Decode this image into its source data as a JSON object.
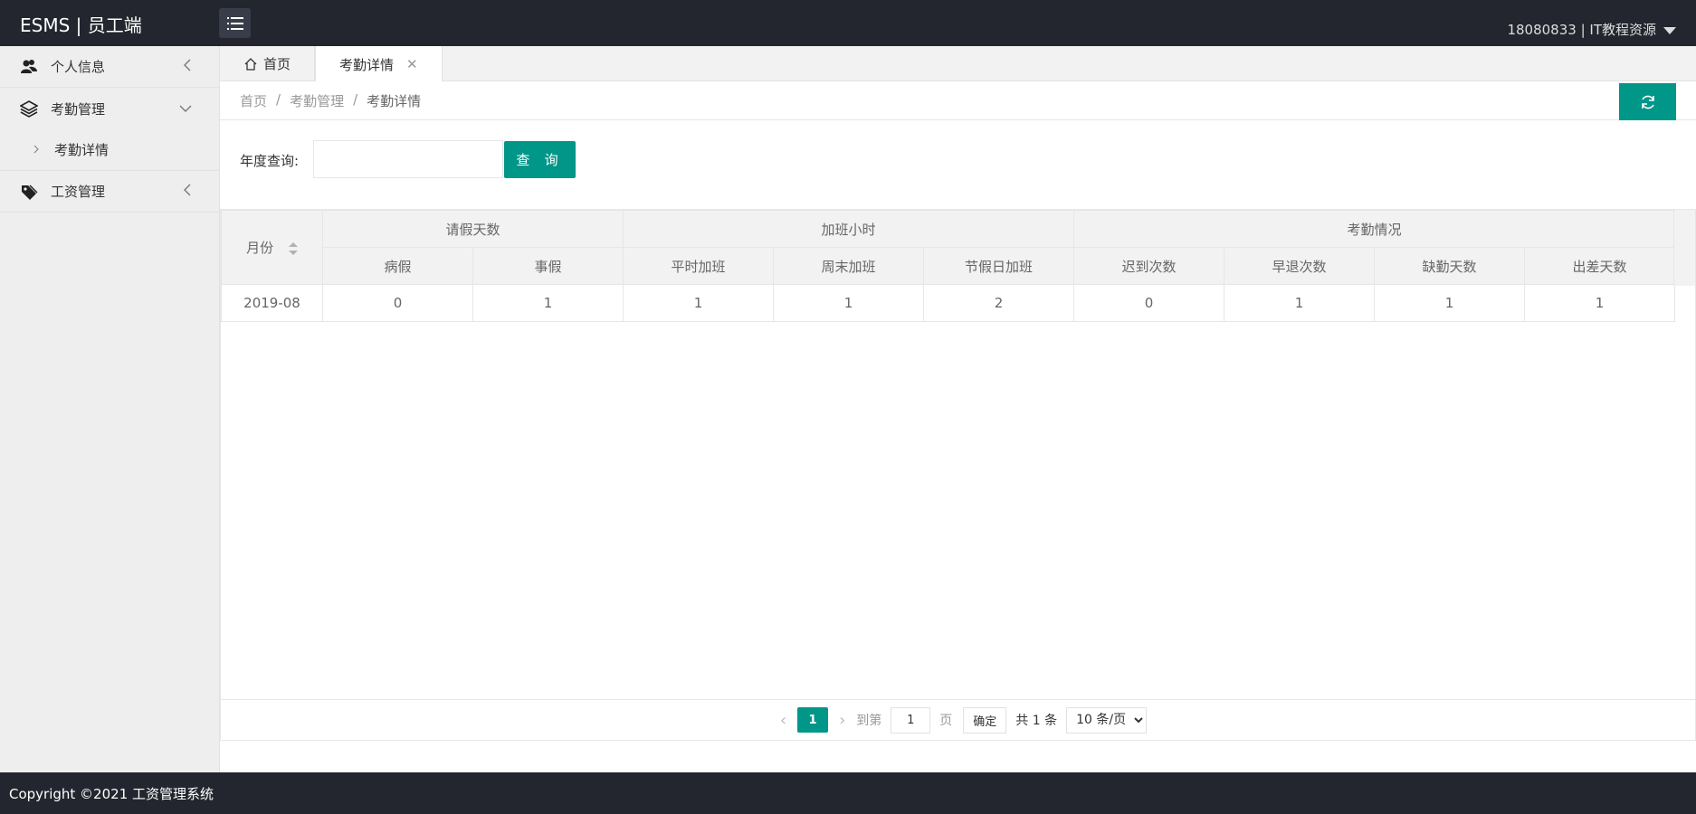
{
  "header": {
    "brand": "ESMS | 员工端",
    "user": "18080833 | IT教程资源"
  },
  "sidebar": {
    "items": [
      {
        "label": "个人信息",
        "icon": "user-group-icon",
        "expanded": false
      },
      {
        "label": "考勤管理",
        "icon": "layers-icon",
        "expanded": true,
        "children": [
          {
            "label": "考勤详情"
          }
        ]
      },
      {
        "label": "工资管理",
        "icon": "tag-icon",
        "expanded": false
      }
    ]
  },
  "tabs": [
    {
      "label": "首页",
      "icon": "home-icon"
    },
    {
      "label": "考勤详情",
      "active": true
    }
  ],
  "breadcrumb": {
    "items": [
      "首页",
      "考勤管理",
      "考勤详情"
    ],
    "separator": "/"
  },
  "query": {
    "label": "年度查询:",
    "value": "",
    "button": "查 询"
  },
  "table": {
    "month_header": "月份",
    "groups": [
      {
        "label": "请假天数",
        "cols": [
          "病假",
          "事假"
        ]
      },
      {
        "label": "加班小时",
        "cols": [
          "平时加班",
          "周末加班",
          "节假日加班"
        ]
      },
      {
        "label": "考勤情况",
        "cols": [
          "迟到次数",
          "早退次数",
          "缺勤天数",
          "出差天数"
        ]
      }
    ],
    "rows": [
      {
        "month": "2019-08",
        "values": [
          "0",
          "1",
          "1",
          "1",
          "2",
          "0",
          "1",
          "1",
          "1"
        ]
      }
    ]
  },
  "pager": {
    "current": "1",
    "goto_label": "到第",
    "goto_value": "1",
    "page_unit": "页",
    "confirm": "确定",
    "total": "共 1 条",
    "page_size": "10 条/页"
  },
  "footer": {
    "text": "Copyright ©2021 工资管理系统"
  },
  "colors": {
    "accent": "#009688",
    "header_bg": "#23262e",
    "sidebar_bg": "#eeeeee"
  }
}
